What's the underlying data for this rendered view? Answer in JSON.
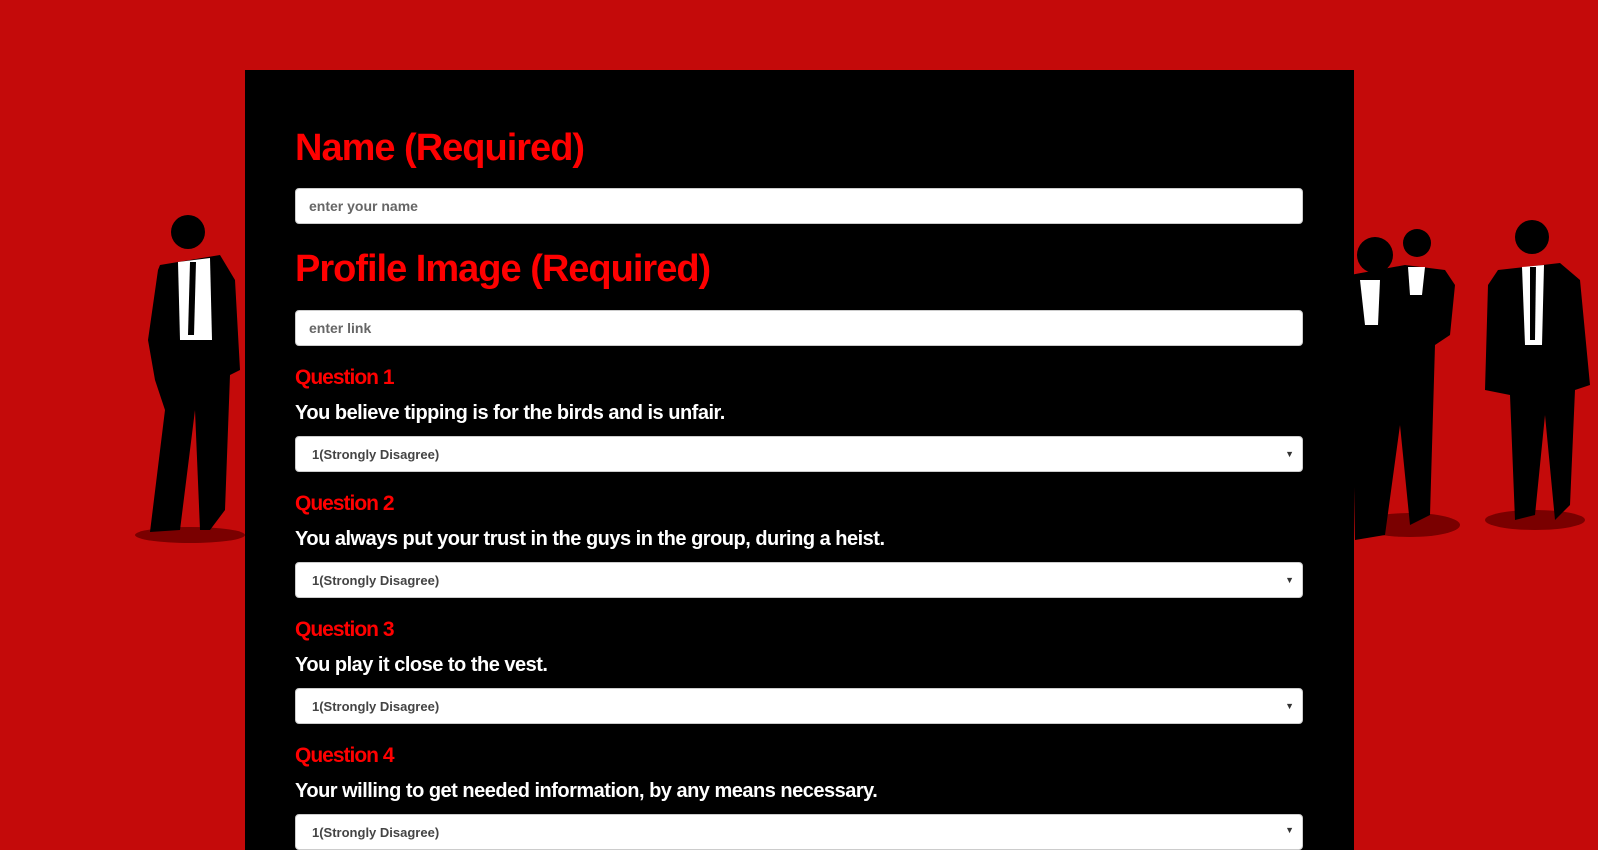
{
  "form": {
    "name_label": "Name (Required)",
    "name_placeholder": "enter your name",
    "image_label": "Profile Image (Required)",
    "image_placeholder": "enter link",
    "questions": [
      {
        "label": "Question 1",
        "text": "You believe tipping is for the birds and is unfair.",
        "selected": "1(Strongly Disagree)"
      },
      {
        "label": "Question 2",
        "text": "You always put your trust in the guys in the group, during a heist.",
        "selected": "1(Strongly Disagree)"
      },
      {
        "label": "Question 3",
        "text": "You play it close to the vest.",
        "selected": "1(Strongly Disagree)"
      },
      {
        "label": "Question 4",
        "text": "Your willing to get needed information, by any means necessary.",
        "selected": "1(Strongly Disagree)"
      }
    ]
  },
  "colors": {
    "background": "#c40a0a",
    "panel": "#000000",
    "heading": "#ff0000"
  }
}
